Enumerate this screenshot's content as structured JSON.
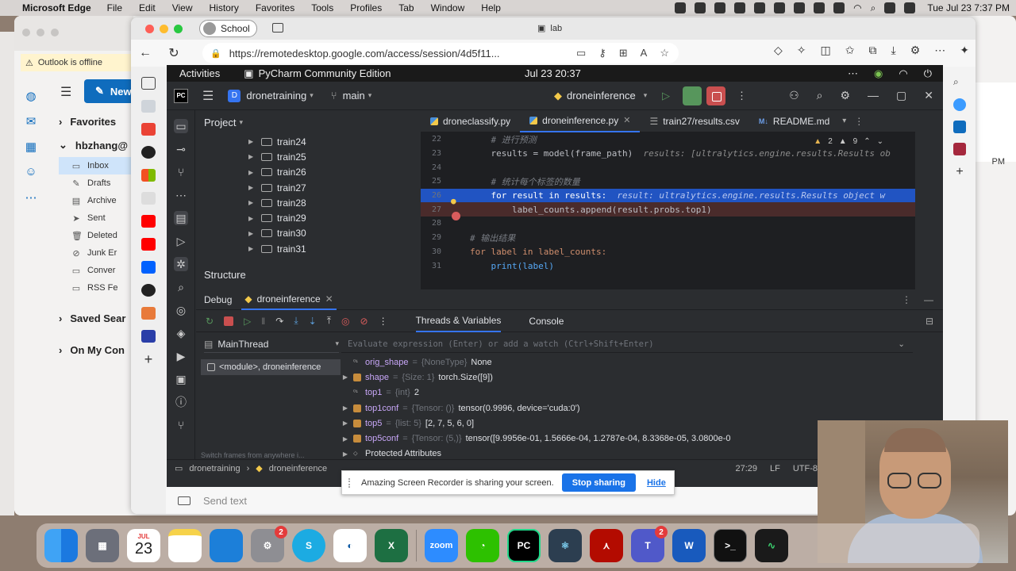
{
  "mac_menubar": {
    "app": "Microsoft Edge",
    "menus": [
      "File",
      "Edit",
      "View",
      "History",
      "Favorites",
      "Tools",
      "Profiles",
      "Tab",
      "Window",
      "Help"
    ],
    "clock": "Tue Jul 23  7:37 PM"
  },
  "outlook": {
    "offline_banner": "Outlook is offline",
    "new_button": "New",
    "favorites": "Favorites",
    "account": "hbzhang@",
    "folders": [
      "Inbox",
      "Drafts",
      "Archive",
      "Sent",
      "Deleted",
      "Junk Er",
      "Conver",
      "RSS Fe"
    ],
    "saved_searches": "Saved Sear",
    "on_my_computer": "On My Con",
    "side_time": "PM"
  },
  "edge": {
    "profile": "School",
    "tab_title": "lab",
    "url": "https://remotedesktop.google.com/access/session/4d5f11..."
  },
  "ubuntu": {
    "activities": "Activities",
    "app_name": "PyCharm Community Edition",
    "datetime": "Jul 23  20:37"
  },
  "pycharm": {
    "logo": "PC",
    "project_badge": "D",
    "project_name": "dronetraining",
    "branch": "main",
    "run_config": "droneinference",
    "project_panel_title": "Project",
    "tree": [
      "train24",
      "train25",
      "train26",
      "train27",
      "train28",
      "train29",
      "train30",
      "train31"
    ],
    "structure_title": "Structure",
    "tabs": [
      {
        "label": "droneclassify.py",
        "kind": "py"
      },
      {
        "label": "droneinference.py",
        "kind": "py"
      },
      {
        "label": "train27/results.csv",
        "kind": "csv"
      },
      {
        "label": "README.md",
        "kind": "md"
      }
    ],
    "inspections": {
      "warnings": "2",
      "typos": "9"
    },
    "code": [
      {
        "n": "22",
        "text": "    # 进行预测"
      },
      {
        "n": "23",
        "text": "    results = model(frame_path)",
        "hint": "  results: [ultralytics.engine.results.Results ob"
      },
      {
        "n": "24",
        "text": ""
      },
      {
        "n": "25",
        "text": "    # 统计每个标签的数量"
      },
      {
        "n": "26",
        "text": "    for result in results:",
        "hint": "  result: ultralytics.engine.results.Results object w"
      },
      {
        "n": "27",
        "text": "        label_counts.append(result.probs.top1)"
      },
      {
        "n": "28",
        "text": ""
      },
      {
        "n": "29",
        "text": "# 输出结果"
      },
      {
        "n": "30",
        "text": "for label in label_counts:"
      },
      {
        "n": "31",
        "text": "    print(label)"
      }
    ],
    "debug": {
      "title": "Debug",
      "config": "droneinference",
      "tab_threads": "Threads & Variables",
      "tab_console": "Console",
      "thread": "MainThread",
      "frame": "<module>, droneinference",
      "switch_hint": "Switch frames from anywhere i...",
      "eval_placeholder": "Evaluate expression (Enter) or add a watch (Ctrl+Shift+Enter)",
      "variables": [
        {
          "name": "orig_shape",
          "type": "{NoneType}",
          "value": "None",
          "expand": false,
          "icon": "int"
        },
        {
          "name": "shape",
          "type": "{Size: 1}",
          "value": "torch.Size([9])",
          "expand": true,
          "icon": "obj"
        },
        {
          "name": "top1",
          "type": "{int}",
          "value": "2",
          "expand": false,
          "icon": "int"
        },
        {
          "name": "top1conf",
          "type": "{Tensor: ()}",
          "value": "tensor(0.9996, device='cuda:0')",
          "expand": true,
          "icon": "obj"
        },
        {
          "name": "top5",
          "type": "{list: 5}",
          "value": "[2, 7, 5, 6, 0]",
          "expand": true,
          "icon": "obj"
        },
        {
          "name": "top5conf",
          "type": "{Tensor: (5,)}",
          "value": "tensor([9.9956e-01, 1.5666e-04, 1.2787e-04, 8.3368e-05, 3.0800e-0",
          "expand": true,
          "icon": "obj"
        },
        {
          "name": "Protected Attributes",
          "type": "",
          "value": "",
          "expand": true,
          "icon": "prot"
        }
      ]
    },
    "status": {
      "project": "dronetraining",
      "file": "droneinference",
      "position": "27:29",
      "line_sep": "LF",
      "encoding": "UTF-8"
    }
  },
  "remote_input": {
    "placeholder": "Send text"
  },
  "share_banner": {
    "message": "Amazing Screen Recorder is sharing your screen.",
    "stop": "Stop sharing",
    "hide": "Hide"
  },
  "dock": {
    "calendar_month": "JUL",
    "calendar_day": "23",
    "settings_badge": "2",
    "teams_badge": "2",
    "zoom_label": "zoom",
    "pycharm_label": "PC",
    "terminal_label": ">_"
  }
}
